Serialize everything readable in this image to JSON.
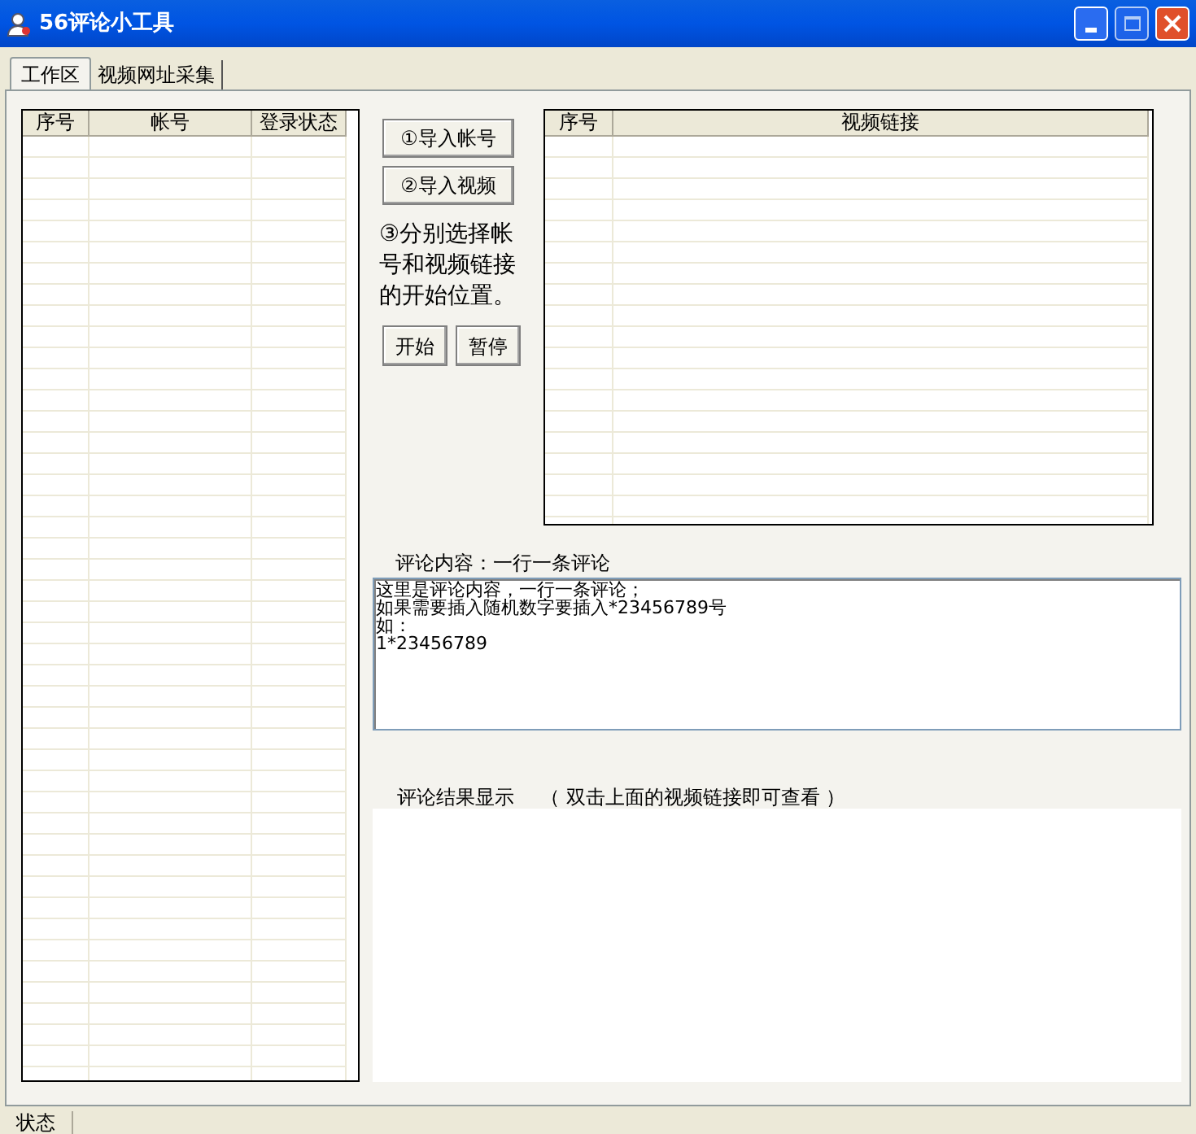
{
  "window": {
    "title": "56评论小工具"
  },
  "tabs": [
    {
      "label": "工作区",
      "selected": true
    },
    {
      "label": "视频网址采集",
      "selected": false
    }
  ],
  "accounts_table": {
    "columns": [
      "序号",
      "帐号",
      "登录状态"
    ]
  },
  "buttons": [
    {
      "label": "①导入帐号"
    },
    {
      "label": "②导入视频"
    }
  ],
  "hint": "③分别选择帐号和视频链接的开始位置。",
  "actions": [
    {
      "label": "开始"
    },
    {
      "label": "暂停"
    }
  ],
  "videos_table": {
    "columns": [
      "序号",
      "视频链接"
    ]
  },
  "comment": {
    "label": "评论内容：一行一条评论",
    "lines": [
      "这里是评论内容，一行一条评论；",
      "如果需要插入随机数字要插入*23456789号",
      "如：",
      "1*23456789"
    ]
  },
  "result": {
    "label": "评论结果显示",
    "note": "（ 双击上面的视频链接即可查看 ）"
  },
  "status_bar": {
    "label": "状态"
  }
}
